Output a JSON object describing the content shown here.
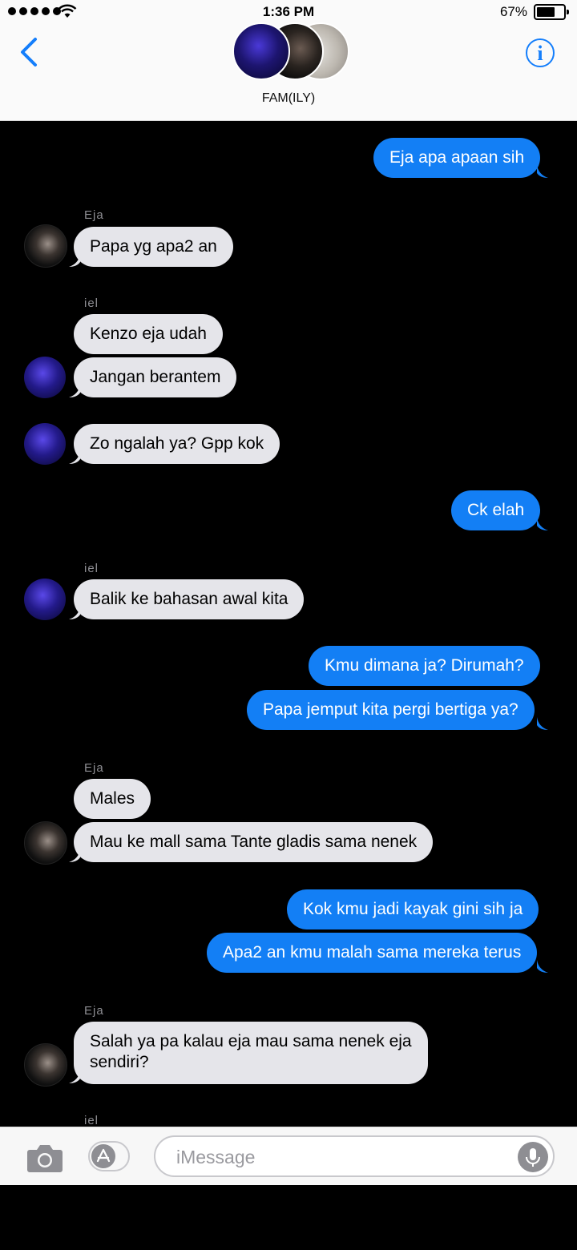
{
  "status": {
    "time": "1:36 PM",
    "battery": "67%"
  },
  "header": {
    "group_name": "FAM(ILY)"
  },
  "senders": {
    "eja1": "Eja",
    "iel1": "iel",
    "iel2": "iel",
    "eja2": "Eja",
    "eja3": "Eja",
    "iel3": "iel"
  },
  "messages": {
    "m1": "Eja apa apaan sih",
    "m2": "Papa yg apa2 an",
    "m3": "Kenzo eja udah",
    "m4": "Jangan berantem",
    "m5": "Zo ngalah ya? Gpp kok",
    "m6": "Ck elah",
    "m7": "Balik ke bahasan awal kita",
    "m8": "Kmu dimana ja? Dirumah?",
    "m9": "Papa jemput kita pergi bertiga ya?",
    "m10": "Males",
    "m11": "Mau ke mall sama Tante gladis sama nenek",
    "m12": "Kok kmu jadi kayak gini sih ja",
    "m13": "Apa2 an kmu malah sama mereka terus",
    "m14": "Salah ya pa kalau eja mau sama nenek eja",
    "m14b": "sendiri?"
  },
  "input": {
    "placeholder": "iMessage"
  },
  "colors": {
    "outgoing": "#137ff5",
    "incoming": "#e5e5ea",
    "accent": "#147efb"
  }
}
